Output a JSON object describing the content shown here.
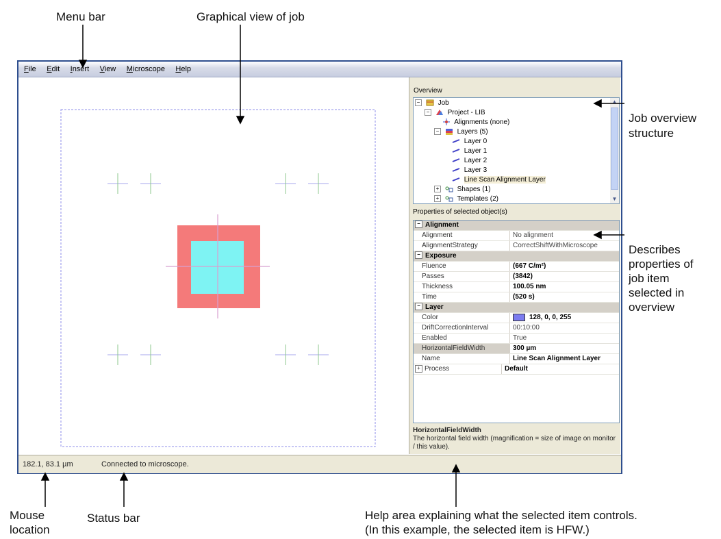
{
  "annotations": {
    "menu_bar": "Menu bar",
    "graphical_view": "Graphical view of  job",
    "job_overview_line1": "Job overview",
    "job_overview_line2": "structure",
    "describes_line1": "Describes",
    "describes_line2": "properties of",
    "describes_line3": "job item",
    "describes_line4": "selected in",
    "describes_line5": "overview",
    "mouse_line1": "Mouse",
    "mouse_line2": "location",
    "status_bar": "Status bar",
    "help_line1": "Help area explaining what the selected item controls.",
    "help_line2": "(In this example, the selected item is HFW.)"
  },
  "menu": {
    "file": {
      "mnemonic": "F",
      "rest": "ile"
    },
    "edit": {
      "mnemonic": "E",
      "rest": "dit"
    },
    "insert": {
      "mnemonic": "I",
      "rest": "nsert"
    },
    "view": {
      "mnemonic": "V",
      "rest": "iew"
    },
    "microscope": {
      "mnemonic": "M",
      "rest": "icroscope"
    },
    "help": {
      "mnemonic": "H",
      "rest": "elp"
    }
  },
  "overview": {
    "title": "Overview",
    "items": [
      {
        "label": "Job",
        "icon": "job-icon"
      },
      {
        "label": "Project - LIB",
        "icon": "project-icon"
      },
      {
        "label": "Alignments (none)",
        "icon": "alignment-icon"
      },
      {
        "label": "Layers (5)",
        "icon": "layers-icon"
      },
      {
        "label": "Layer 0",
        "icon": "layer-icon"
      },
      {
        "label": "Layer 1",
        "icon": "layer-icon"
      },
      {
        "label": "Layer 2",
        "icon": "layer-icon"
      },
      {
        "label": "Layer 3",
        "icon": "layer-icon"
      },
      {
        "label": "Line Scan Alignment Layer",
        "icon": "layer-icon",
        "selected": true
      },
      {
        "label": "Shapes (1)",
        "icon": "shapes-icon"
      },
      {
        "label": "Templates (2)",
        "icon": "templates-icon"
      }
    ]
  },
  "properties": {
    "title": "Properties of selected object(s)",
    "alignment_cat": "Alignment",
    "alignment_name": "Alignment",
    "alignment_value": "No alignment",
    "strategy_name": "AlignmentStrategy",
    "strategy_value": "CorrectShiftWithMicroscope",
    "exposure_cat": "Exposure",
    "fluence_name": "Fluence",
    "fluence_value": "(667 C/m²)",
    "passes_name": "Passes",
    "passes_value": "(3842)",
    "thickness_name": "Thickness",
    "thickness_value": "100.05 nm",
    "time_name": "Time",
    "time_value": "(520 s)",
    "layer_cat": "Layer",
    "color_name": "Color",
    "color_value": "128, 0, 0, 255",
    "color_swatch": "#7b7bf0",
    "drift_name": "DriftCorrectionInterval",
    "drift_value": "00:10:00",
    "enabled_name": "Enabled",
    "enabled_value": "True",
    "hfw_name": "HorizontalFieldWidth",
    "hfw_value": "300 µm",
    "name_name": "Name",
    "name_value": "Line Scan Alignment Layer",
    "process_name": "Process",
    "process_value": "Default"
  },
  "help": {
    "title": "HorizontalFieldWidth",
    "text": "The horizontal field width (magnification = size of image on monitor / this value)."
  },
  "status": {
    "mouse_location": "182.1, 83.1 µm",
    "message": "Connected to microscope."
  },
  "colors": {
    "outer_square": "#f47a7a",
    "inner_square": "#7ef3f3",
    "boundary": "#8c8ce8",
    "crosshair": "#d8a0d0",
    "marker_h": "#a7a7ee",
    "marker_v": "#8cc78c"
  }
}
